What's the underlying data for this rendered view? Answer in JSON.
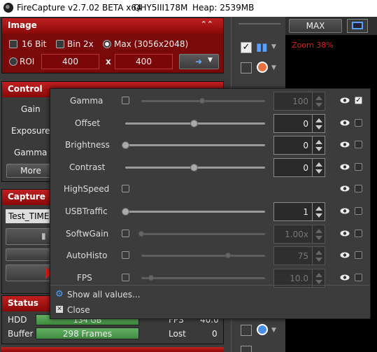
{
  "titlebar": {
    "app": "FireCapture v2.7.02 BETA x64",
    "camera": "QHY5III178M",
    "heap": "Heap: 2539MB"
  },
  "image": {
    "title": "Image",
    "bit16": "16 Bit",
    "bin2x": "Bin 2x",
    "max": "Max (3056x2048)",
    "roi": "ROI",
    "roi_w": "400",
    "x": "x",
    "roi_h": "400"
  },
  "control": {
    "title": "Control",
    "labels": [
      "Gain",
      "Exposure",
      "Gamma"
    ],
    "more": "More"
  },
  "capture": {
    "title": "Capture",
    "profile": "Test_TIME"
  },
  "status": {
    "title": "Status",
    "hdd_label": "HDD",
    "hdd_value": "134 GB",
    "fps_label": "FPS",
    "fps_value": "40.0",
    "buffer_label": "Buffer",
    "buffer_value": "298 Frames",
    "lost_label": "Lost",
    "lost_value": "0"
  },
  "right": {
    "max_button": "MAX",
    "zoom": "Zoom 38%"
  },
  "popup": {
    "rows": [
      {
        "name": "Gamma",
        "value": "100",
        "slider": 0.49,
        "enabled": false,
        "auto_cb": true,
        "slider_disabled": true,
        "visible_checked": true
      },
      {
        "name": "Offset",
        "value": "0",
        "slider": 0.49,
        "enabled": true,
        "auto_cb": false,
        "slider_disabled": false,
        "visible_checked": false
      },
      {
        "name": "Brightness",
        "value": "0",
        "slider": 0.0,
        "enabled": true,
        "auto_cb": false,
        "slider_disabled": false,
        "visible_checked": false
      },
      {
        "name": "Contrast",
        "value": "0",
        "slider": 0.49,
        "enabled": true,
        "auto_cb": false,
        "slider_disabled": false,
        "visible_checked": false
      },
      {
        "name": "HighSpeed",
        "value": "",
        "slider": null,
        "enabled": true,
        "auto_cb": true,
        "slider_disabled": false,
        "visible_checked": false
      },
      {
        "name": "USBTraffic",
        "value": "1",
        "slider": 0.0,
        "enabled": true,
        "auto_cb": false,
        "slider_disabled": false,
        "visible_checked": false
      },
      {
        "name": "SoftwGain",
        "value": "1.00x",
        "slider": 0.0,
        "enabled": false,
        "auto_cb": true,
        "slider_disabled": true,
        "visible_checked": false
      },
      {
        "name": "AutoHisto",
        "value": "75",
        "slider": 0.7,
        "enabled": false,
        "auto_cb": true,
        "slider_disabled": true,
        "visible_checked": false
      },
      {
        "name": "FPS",
        "value": "10.0",
        "slider": 0.08,
        "enabled": false,
        "auto_cb": true,
        "slider_disabled": true,
        "visible_checked": false
      }
    ],
    "show_all": "Show all values...",
    "close": "Close"
  }
}
